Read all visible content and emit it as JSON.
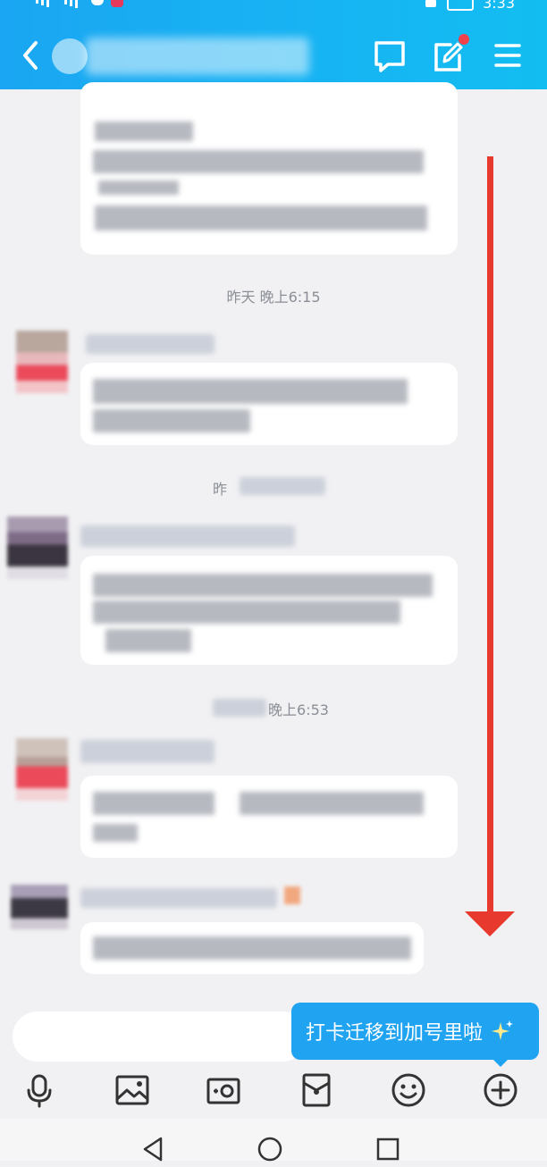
{
  "status_bar": {
    "time": "3:33"
  },
  "header": {
    "back_icon": "chevron-left-icon",
    "icons": [
      "chat-bubble-icon",
      "edit-icon",
      "menu-icon"
    ],
    "accent": "#17b0f3"
  },
  "messages": {
    "timestamps": [
      "昨天 晚上6:15",
      "昨",
      "晚上6:53"
    ]
  },
  "input": {
    "tooltip": "打卡迁移到加号里啦",
    "tooltip_icon": "sparkle-icon"
  },
  "toolbar": {
    "icons": [
      "microphone-icon",
      "image-icon",
      "camera-icon",
      "red-packet-icon",
      "emoji-icon",
      "plus-icon"
    ]
  },
  "nav": {
    "icons": [
      "back-triangle-icon",
      "home-circle-icon",
      "recent-square-icon"
    ]
  },
  "annotation": {
    "arrow_color": "#e8392f"
  }
}
